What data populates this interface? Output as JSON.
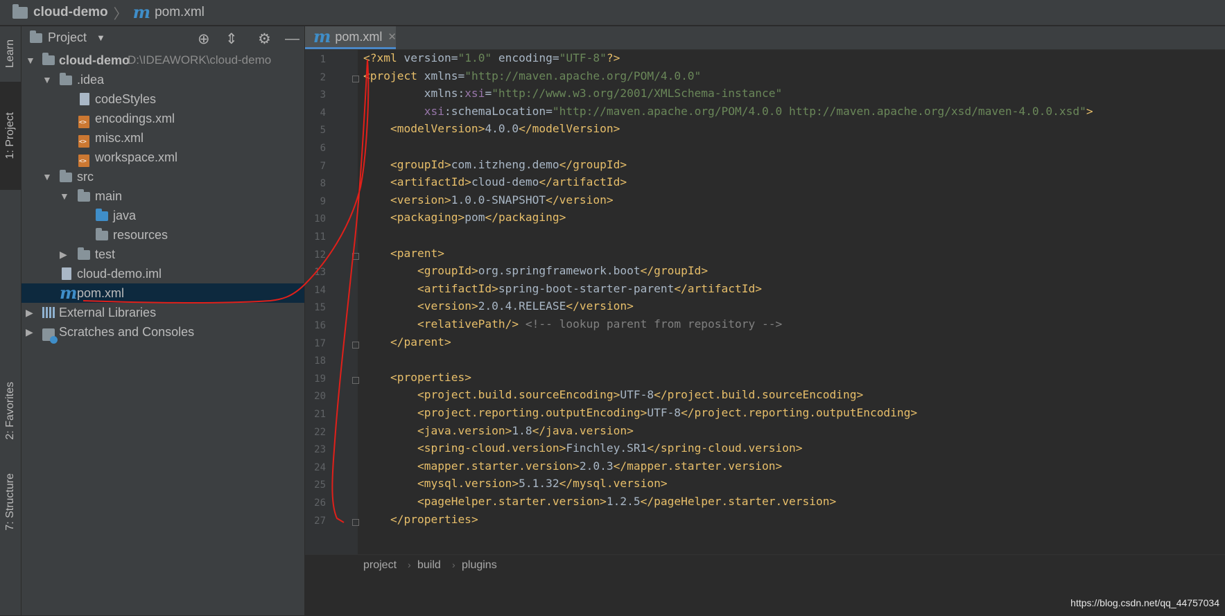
{
  "breadcrumb": {
    "project": "cloud-demo",
    "file": "pom.xml"
  },
  "left_strip": {
    "learn": "Learn",
    "project": "1: Project",
    "favorites": "2: Favorites",
    "structure": "7: Structure"
  },
  "project_panel": {
    "title": "Project",
    "tree": [
      {
        "label": "cloud-demo",
        "path": "D:\\IDEAWORK\\cloud-demo"
      },
      {
        "label": ".idea"
      },
      {
        "label": "codeStyles"
      },
      {
        "label": "encodings.xml"
      },
      {
        "label": "misc.xml"
      },
      {
        "label": "workspace.xml"
      },
      {
        "label": "src"
      },
      {
        "label": "main"
      },
      {
        "label": "java"
      },
      {
        "label": "resources"
      },
      {
        "label": "test"
      },
      {
        "label": "cloud-demo.iml"
      },
      {
        "label": "pom.xml"
      },
      {
        "label": "External Libraries"
      },
      {
        "label": "Scratches and Consoles"
      }
    ]
  },
  "editor": {
    "tab": "pom.xml",
    "line_numbers": [
      "1",
      "2",
      "3",
      "4",
      "5",
      "6",
      "7",
      "8",
      "9",
      "10",
      "11",
      "12",
      "13",
      "14",
      "15",
      "16",
      "17",
      "18",
      "19",
      "20",
      "21",
      "22",
      "23",
      "24",
      "25",
      "26",
      "27"
    ],
    "code": [
      "<?xml version=\"1.0\" encoding=\"UTF-8\"?>",
      "<project xmlns=\"http://maven.apache.org/POM/4.0.0\"",
      "         xmlns:xsi=\"http://www.w3.org/2001/XMLSchema-instance\"",
      "         xsi:schemaLocation=\"http://maven.apache.org/POM/4.0.0 http://maven.apache.org/xsd/maven-4.0.0.xsd\">",
      "    <modelVersion>4.0.0</modelVersion>",
      "",
      "    <groupId>com.itzheng.demo</groupId>",
      "    <artifactId>cloud-demo</artifactId>",
      "    <version>1.0.0-SNAPSHOT</version>",
      "    <packaging>pom</packaging>",
      "",
      "    <parent>",
      "        <groupId>org.springframework.boot</groupId>",
      "        <artifactId>spring-boot-starter-parent</artifactId>",
      "        <version>2.0.4.RELEASE</version>",
      "        <relativePath/> <!-- lookup parent from repository -->",
      "    </parent>",
      "",
      "    <properties>",
      "        <project.build.sourceEncoding>UTF-8</project.build.sourceEncoding>",
      "        <project.reporting.outputEncoding>UTF-8</project.reporting.outputEncoding>",
      "        <java.version>1.8</java.version>",
      "        <spring-cloud.version>Finchley.SR1</spring-cloud.version>",
      "        <mapper.starter.version>2.0.3</mapper.starter.version>",
      "        <mysql.version>5.1.32</mysql.version>",
      "        <pageHelper.starter.version>1.2.5</pageHelper.starter.version>",
      "    </properties>"
    ],
    "crumbs": [
      "project",
      "build",
      "plugins"
    ]
  },
  "watermark": "https://blog.csdn.net/qq_44757034",
  "colors": {
    "tag": "#e8bf6a",
    "string": "#6a8759",
    "namespace": "#9876aa",
    "comment": "#808080",
    "selection": "#0d293e",
    "annotation": "#e0201a"
  }
}
